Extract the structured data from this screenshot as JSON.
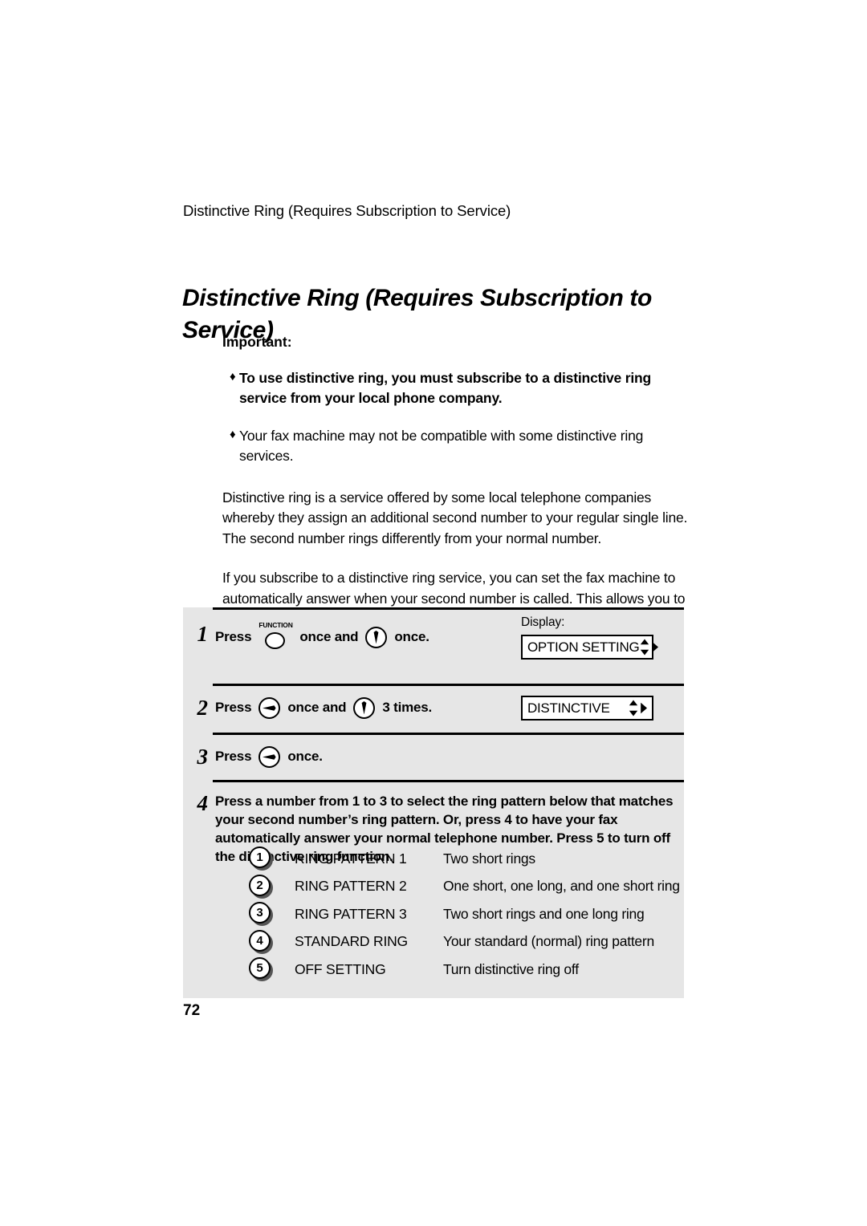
{
  "page": {
    "running_header": "Distinctive Ring (Requires Subscription to Service)",
    "title": "Distinctive Ring (Requires Subscription to Service)",
    "folio": "72"
  },
  "important": {
    "label": "Important:",
    "bullet_glyph": "♦",
    "items": [
      {
        "text": "To use distinctive ring, you must subscribe to a distinctive ring service from your local phone company.",
        "bold": true
      },
      {
        "text": "Your fax machine may not be compatible with some distinctive ring services.",
        "bold": false
      }
    ]
  },
  "paragraphs": [
    "Distinctive ring is a service offered by some local telephone companies whereby they assign an additional second number to your regular single line. The second number rings differently from your normal number.",
    "If you subscribe to a distinctive ring service, you can set the fax machine to automatically answer when your second number is called. This allows you to use the second number as an exclusive fax number. To have your fax automatically answer when your second number is called, follow the steps below:"
  ],
  "procedure": {
    "display_label": "Display:",
    "steps": [
      {
        "number": "1",
        "press_label": "Press",
        "key1": "function-key",
        "key1_label": "FUNCTION",
        "mid_text": "once and",
        "key2": "down-arrow-key",
        "tail_text": "once.",
        "display": "OPTION SETTING"
      },
      {
        "number": "2",
        "press_label": "Press",
        "key1": "right-arrow-key",
        "mid_text": "once and",
        "key2": "down-arrow-key",
        "tail_text": "3 times.",
        "display": "DISTINCTIVE"
      },
      {
        "number": "3",
        "press_label": "Press",
        "key1": "right-arrow-key",
        "tail_text": "once.",
        "display": ""
      },
      {
        "number": "4",
        "text": "Press a number from 1 to 3 to select the ring pattern below that matches your second number’s ring pattern. Or, press 4 to have your fax automatically answer your normal telephone number. Press 5 to turn off the distinctive ring function."
      }
    ]
  },
  "ring_patterns": [
    {
      "key": "1",
      "name": "RING PATTERN 1",
      "description": "Two short rings"
    },
    {
      "key": "2",
      "name": "RING PATTERN 2",
      "description": "One short, one long, and one short ring"
    },
    {
      "key": "3",
      "name": "RING PATTERN 3",
      "description": "Two short rings and one long ring"
    },
    {
      "key": "4",
      "name": "STANDARD RING",
      "description": "Your standard (normal) ring pattern"
    },
    {
      "key": "5",
      "name": "OFF SETTING",
      "description": "Turn distinctive ring off"
    }
  ],
  "colors": {
    "panel_background": "#e6e6e6",
    "page_background": "#ffffff",
    "ink": "#000000"
  }
}
